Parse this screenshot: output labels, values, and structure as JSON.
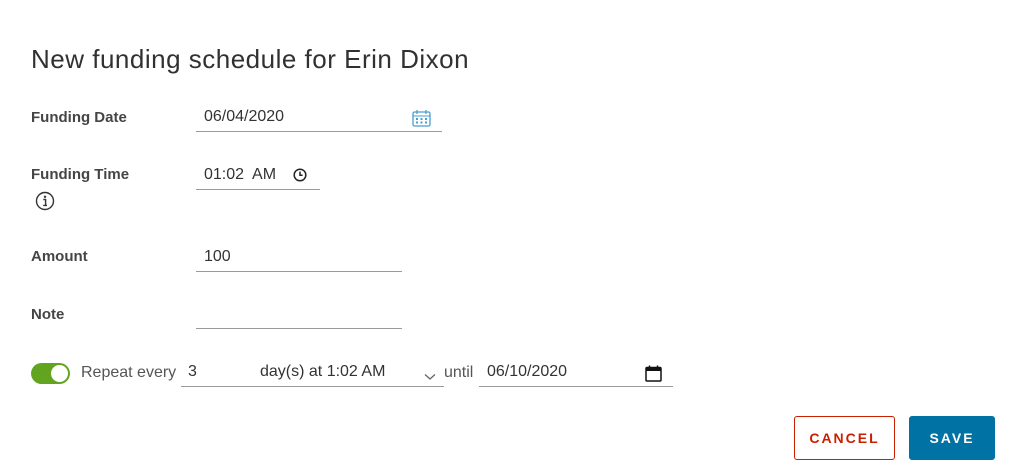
{
  "dialog": {
    "title": "New funding schedule for Erin Dixon"
  },
  "form": {
    "funding_date": {
      "label": "Funding Date",
      "value": "06/04/2020",
      "icon": "calendar-icon"
    },
    "funding_time": {
      "label": "Funding Time",
      "value": "01:02  AM",
      "icon": "clock-icon",
      "info_icon": "info-icon"
    },
    "amount": {
      "label": "Amount",
      "value": "100"
    },
    "note": {
      "label": "Note",
      "value": ""
    }
  },
  "repeat": {
    "enabled": true,
    "label": "Repeat every",
    "interval_value": "3",
    "unit_selected": "day(s) at 1:02 AM",
    "until_label": "until",
    "until_date": "06/10/2020",
    "toggle_color": "#62a420"
  },
  "actions": {
    "cancel_label": "CANCEL",
    "save_label": "SAVE",
    "cancel_color": "#c92100",
    "save_color": "#0072a3"
  }
}
